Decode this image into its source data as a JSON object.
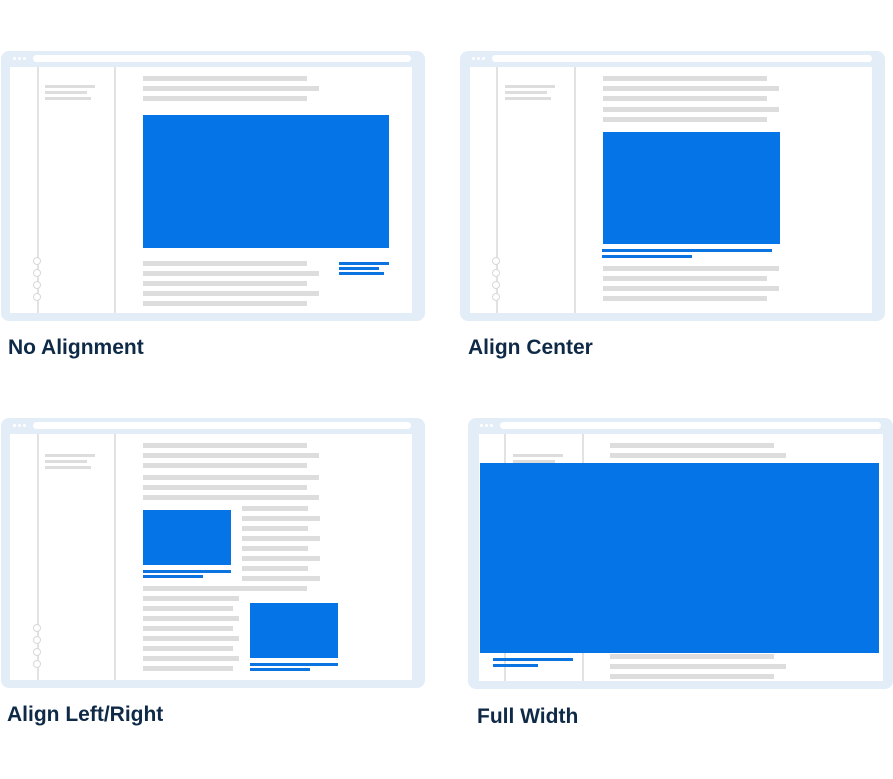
{
  "panels": [
    {
      "caption": "No Alignment"
    },
    {
      "caption": "Align Center"
    },
    {
      "caption": "Align Left/Right"
    },
    {
      "caption": "Full Width"
    }
  ],
  "colors": {
    "frame": "#e3edf8",
    "image_block": "#0474e6",
    "caption_line": "#0b74e0",
    "text_line": "#dddddd",
    "label": "#0e2a47"
  }
}
